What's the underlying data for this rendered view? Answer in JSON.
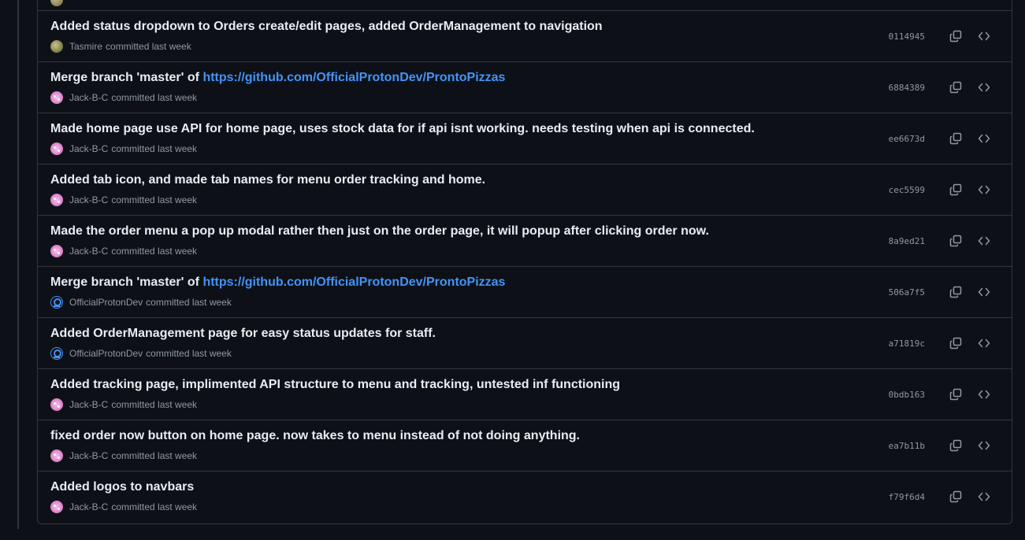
{
  "commits": [
    {
      "title": "Added status dropdown to Orders create/edit pages, added OrderManagement to navigation",
      "title_link": "",
      "author": "Tasmire",
      "avatar": "tasmire",
      "meta": "committed last week",
      "sha": "0114945"
    },
    {
      "title": "Merge branch 'master' of ",
      "title_link": "https://github.com/OfficialProtonDev/ProntoPizzas",
      "author": "Jack-B-C",
      "avatar": "jack",
      "meta": "committed last week",
      "sha": "6884389"
    },
    {
      "title": "Made home page use API for home page, uses stock data for if api isnt working. needs testing when api is connected.",
      "title_link": "",
      "author": "Jack-B-C",
      "avatar": "jack",
      "meta": "committed last week",
      "sha": "ee6673d"
    },
    {
      "title": "Added tab icon, and made tab names for menu order tracking and home.",
      "title_link": "",
      "author": "Jack-B-C",
      "avatar": "jack",
      "meta": "committed last week",
      "sha": "cec5599"
    },
    {
      "title": "Made the order menu a pop up modal rather then just on the order page, it will popup after clicking order now.",
      "title_link": "",
      "author": "Jack-B-C",
      "avatar": "jack",
      "meta": "committed last week",
      "sha": "8a9ed21"
    },
    {
      "title": "Merge branch 'master' of ",
      "title_link": "https://github.com/OfficialProtonDev/ProntoPizzas",
      "author": "OfficialProtonDev",
      "avatar": "proton",
      "meta": "committed last week",
      "sha": "506a7f5"
    },
    {
      "title": "Added OrderManagement page for easy status updates for staff.",
      "title_link": "",
      "author": "OfficialProtonDev",
      "avatar": "proton",
      "meta": "committed last week",
      "sha": "a71819c"
    },
    {
      "title": "Added tracking page, implimented API structure to menu and tracking, untested inf functioning",
      "title_link": "",
      "author": "Jack-B-C",
      "avatar": "jack",
      "meta": "committed last week",
      "sha": "0bdb163"
    },
    {
      "title": "fixed order now button on home page. now takes to menu instead of not doing anything.",
      "title_link": "",
      "author": "Jack-B-C",
      "avatar": "jack",
      "meta": "committed last week",
      "sha": "ea7b11b"
    },
    {
      "title": "Added logos to navbars",
      "title_link": "",
      "author": "Jack-B-C",
      "avatar": "jack",
      "meta": "committed last week",
      "sha": "f79f6d4"
    }
  ],
  "icons": {
    "copy": "copy-icon",
    "browse": "code-icon"
  },
  "colors": {
    "background": "#0d1117",
    "border": "#30363d",
    "text": "#e6edf3",
    "muted": "#9198a1",
    "link": "#4493f8"
  }
}
